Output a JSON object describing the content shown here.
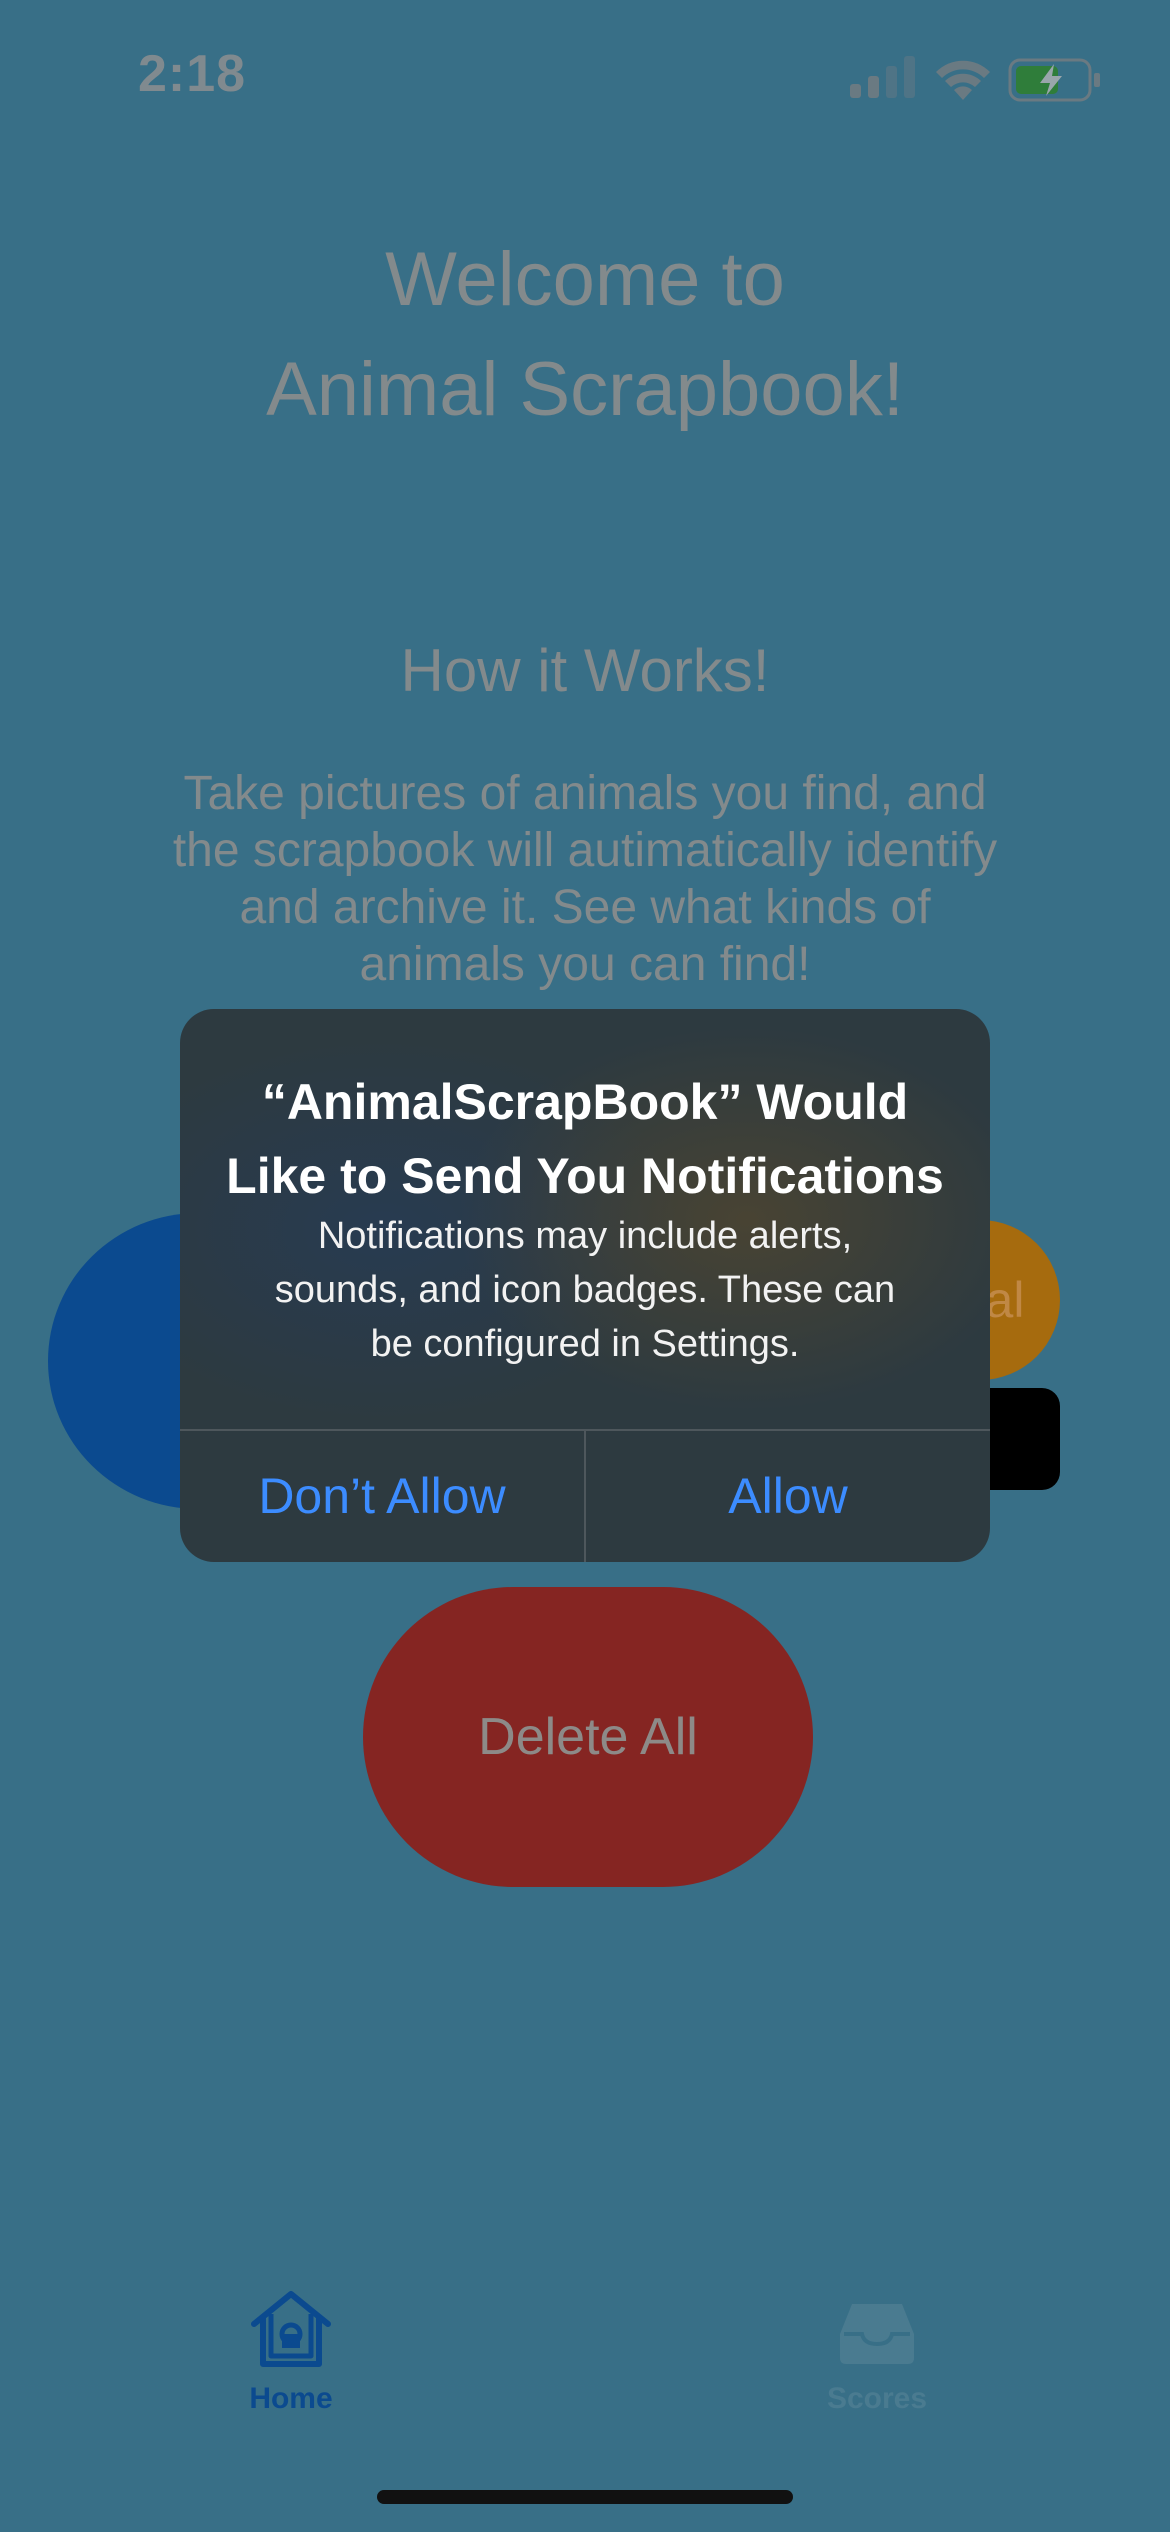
{
  "status_bar": {
    "time": "2:18",
    "icons": [
      "cellular-signal-icon",
      "wifi-icon",
      "battery-charging-icon"
    ]
  },
  "main": {
    "welcome_title": "Welcome to\nAnimal Scrapbook!",
    "how_title": "How it Works!",
    "how_body": "Take pictures of animals you find, and\nthe scrapbook will autimatically identify\nand archive it. See what kinds of\nanimals you can find!",
    "orange_button_partial_label": "al",
    "delete_all_label": "Delete All"
  },
  "alert": {
    "title": "“AnimalScrapBook” Would\nLike to Send You Notifications",
    "message": "Notifications may include alerts,\nsounds, and icon badges. These can\nbe configured in Settings.",
    "dont_allow_label": "Don’t Allow",
    "allow_label": "Allow"
  },
  "tab_bar": {
    "tabs": [
      {
        "label": "Home",
        "icon": "house-icon",
        "selected": true
      },
      {
        "label": "Scores",
        "icon": "tray-icon",
        "selected": false
      }
    ]
  },
  "colors": {
    "background_dim": "#386f87",
    "accent_blue": "#0b4a8f",
    "delete_red": "#852522",
    "orange": "#a66b0e",
    "alert_button_blue": "#3c8cff"
  }
}
